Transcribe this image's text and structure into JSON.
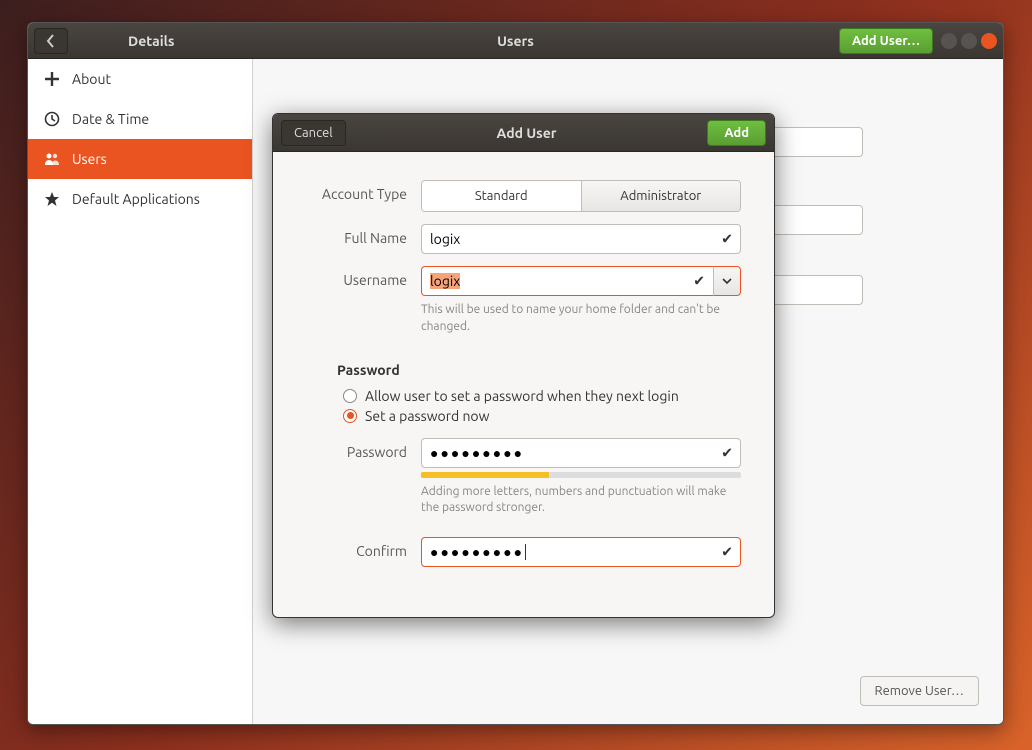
{
  "header": {
    "leftTitle": "Details",
    "centerTitle": "Users",
    "addUserBtn": "Add User…"
  },
  "sidebar": {
    "items": [
      {
        "label": "About"
      },
      {
        "label": "Date & Time"
      },
      {
        "label": "Users"
      },
      {
        "label": "Default Applications"
      }
    ]
  },
  "main": {
    "removeUserBtn": "Remove User…"
  },
  "modal": {
    "cancel": "Cancel",
    "title": "Add User",
    "add": "Add",
    "accountTypeLabel": "Account Type",
    "accountTypeStandard": "Standard",
    "accountTypeAdmin": "Administrator",
    "fullNameLabel": "Full Name",
    "fullNameValue": "logix",
    "usernameLabel": "Username",
    "usernameValue": "logix",
    "usernameNote": "This will be used to name your home folder and can't be changed.",
    "passwordSection": "Password",
    "radioLater": "Allow user to set a password when they next login",
    "radioNow": "Set a password now",
    "passwordLabel": "Password",
    "passwordValue": "●●●●●●●●●",
    "passwordNote": "Adding more letters, numbers and punctuation will make the password stronger.",
    "confirmLabel": "Confirm",
    "confirmValue": "●●●●●●●●●"
  }
}
